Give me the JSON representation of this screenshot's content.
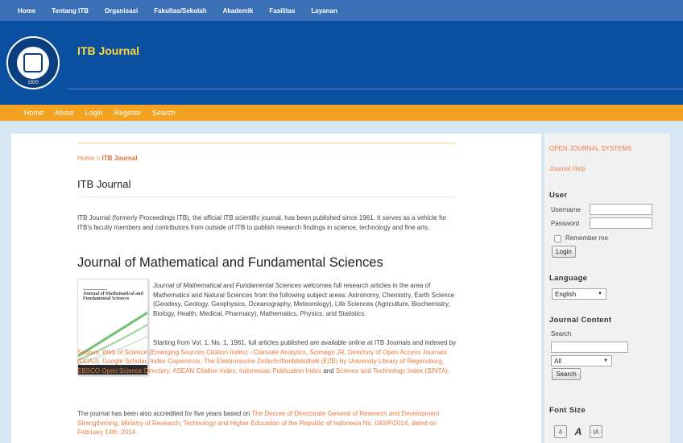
{
  "topnav": [
    "Home",
    "Tentang ITB",
    "Organisasi",
    "Fakultas/Sekolah",
    "Akademik",
    "Fasilitas",
    "Layanan"
  ],
  "header": {
    "title": "ITB Journal",
    "logo_year": "1920"
  },
  "mainnav": [
    "Home",
    "About",
    "Login",
    "Register",
    "Search"
  ],
  "breadcrumb": {
    "home": "Home",
    "sep": " > ",
    "current": "ITB Journal"
  },
  "page_title": "ITB Journal",
  "intro": "ITB Journal (formerly Proceedings ITB), the official ITB scientific journal, has been published since 1961. It serves as a vehicle for ITB's faculty members and contributors from outside of ITB to publish research findings in science, technology and fine arts.",
  "journal": {
    "heading": "Journal of Mathematical and Fundamental Sciences",
    "cover_title": "Journal of Mathematical and Fundamental Sciences",
    "desc_italic": "Journal of Mathematical and Fundamental Sciences",
    "desc_rest": " welcomes full research articles in the area of Mathematics and Natural Sciences from the following subject areas: Astronomy, Chemistry, Earth Science (Geodesy, Geology, Geophysics, Oceanography, Meteorology), Life Sciences (Agriculture, Biochemistry, Biology, Health, Medical, Pharmacy), Mathematics, Physics, and Statistics.",
    "indexed_intro": "Starting from Vol. 1, No. 1, 1961, full articles published are available online at ITB Journals and indexed by ",
    "indexed_links": "Scopus, Web of Science (Emerging Sources Citation Index) - Clarivate Analytics, Scimago JR, Directory of Open Access Journals (DOAJ), Google Scholar,  Index Copernicus, The Elektronische Zeitschriftenbibliothek (EZB) by University Library of Regensburg, EBSCO Open Science Directory, ASEAN Citation Index, Indonesian Publication Index",
    "indexed_and": " and ",
    "indexed_last": "Science and Technology Index (SINTA).",
    "accr_intro": "The journal has been also accredited for five years based on ",
    "accr_link": "The Decree of Directorate General of Research and Development Strengthening, Ministry of Research, Technology and Higher Education of the Republic of Indonesia No. 040/P/2014, dated on February 14th, 2014."
  },
  "sidebar": {
    "ojs": "OPEN JOURNAL SYSTEMS",
    "help": "Journal Help",
    "user_heading": "User",
    "username_label": "Username",
    "password_label": "Password",
    "remember_label": "Remember me",
    "login_button": "Login",
    "language_heading": "Language",
    "language_value": "English",
    "content_heading": "Journal Content",
    "search_label": "Search",
    "search_scope": "All",
    "search_button": "Search",
    "font_heading": "Font Size",
    "font_small": "A̱",
    "font_medium": "A",
    "font_large": "tA"
  },
  "colors": {
    "top_nav": "#3b6fb6",
    "header": "#0a4fa0",
    "main_nav": "#f4a21f",
    "title": "#ffd83a",
    "link": "#ea7a3f"
  }
}
